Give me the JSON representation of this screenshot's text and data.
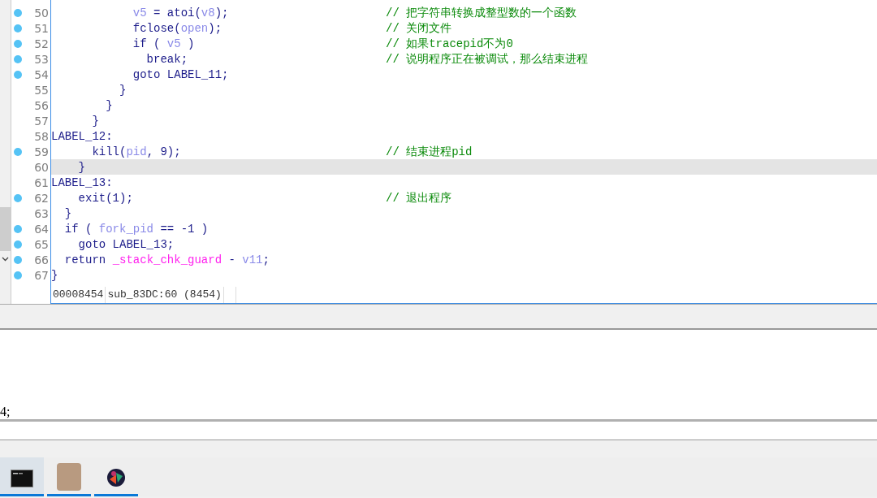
{
  "code_lines": [
    {
      "number": "50",
      "breakpoint": true,
      "selected": false,
      "tokens": [
        {
          "text": "            v5",
          "kind": "lvar"
        },
        {
          "text": " = atoi(",
          "kind": "code"
        },
        {
          "text": "v8",
          "kind": "lvar"
        },
        {
          "text": ");",
          "kind": "code"
        }
      ],
      "comment": "// 把字符串转换成整型数的一个函数"
    },
    {
      "number": "51",
      "breakpoint": true,
      "selected": false,
      "tokens": [
        {
          "text": "            fclose(",
          "kind": "code"
        },
        {
          "text": "open",
          "kind": "lvar"
        },
        {
          "text": ");",
          "kind": "code"
        }
      ],
      "comment": "// 关闭文件"
    },
    {
      "number": "52",
      "breakpoint": true,
      "selected": false,
      "tokens": [
        {
          "text": "            if ( ",
          "kind": "code"
        },
        {
          "text": "v5",
          "kind": "lvar"
        },
        {
          "text": " )",
          "kind": "code"
        }
      ],
      "comment": "// 如果tracepid不为0"
    },
    {
      "number": "53",
      "breakpoint": true,
      "selected": false,
      "tokens": [
        {
          "text": "              break;",
          "kind": "code"
        }
      ],
      "comment": "// 说明程序正在被调试，那么结束进程"
    },
    {
      "number": "54",
      "breakpoint": true,
      "selected": false,
      "tokens": [
        {
          "text": "            goto LABEL_11;",
          "kind": "code"
        }
      ]
    },
    {
      "number": "55",
      "breakpoint": false,
      "selected": false,
      "tokens": [
        {
          "text": "          }",
          "kind": "code"
        }
      ]
    },
    {
      "number": "56",
      "breakpoint": false,
      "selected": false,
      "tokens": [
        {
          "text": "        }",
          "kind": "code"
        }
      ]
    },
    {
      "number": "57",
      "breakpoint": false,
      "selected": false,
      "tokens": [
        {
          "text": "      }",
          "kind": "code"
        }
      ]
    },
    {
      "number": "58",
      "breakpoint": false,
      "selected": false,
      "tokens": [
        {
          "text": "LABEL_12:",
          "kind": "code"
        }
      ]
    },
    {
      "number": "59",
      "breakpoint": true,
      "selected": false,
      "tokens": [
        {
          "text": "      kill(",
          "kind": "code"
        },
        {
          "text": "pid",
          "kind": "lvar"
        },
        {
          "text": ", 9);",
          "kind": "code"
        }
      ],
      "comment": "// 结束进程pid"
    },
    {
      "number": "60",
      "breakpoint": false,
      "selected": true,
      "tokens": [
        {
          "text": "    }",
          "kind": "code"
        }
      ]
    },
    {
      "number": "61",
      "breakpoint": false,
      "selected": false,
      "tokens": [
        {
          "text": "LABEL_13:",
          "kind": "code"
        }
      ]
    },
    {
      "number": "62",
      "breakpoint": true,
      "selected": false,
      "tokens": [
        {
          "text": "    exit(1);",
          "kind": "code"
        }
      ],
      "comment": "// 退出程序"
    },
    {
      "number": "63",
      "breakpoint": false,
      "selected": false,
      "tokens": [
        {
          "text": "  }",
          "kind": "code"
        }
      ]
    },
    {
      "number": "64",
      "breakpoint": true,
      "selected": false,
      "tokens": [
        {
          "text": "  if ( ",
          "kind": "code"
        },
        {
          "text": "fork_pid",
          "kind": "lvar"
        },
        {
          "text": " == -1 )",
          "kind": "code"
        }
      ]
    },
    {
      "number": "65",
      "breakpoint": true,
      "selected": false,
      "tokens": [
        {
          "text": "    goto LABEL_13;",
          "kind": "code"
        }
      ]
    },
    {
      "number": "66",
      "breakpoint": true,
      "selected": false,
      "tokens": [
        {
          "text": "  return ",
          "kind": "code"
        },
        {
          "text": "_stack_chk_guard",
          "kind": "global"
        },
        {
          "text": " - ",
          "kind": "code"
        },
        {
          "text": "v11",
          "kind": "lvar"
        },
        {
          "text": ";",
          "kind": "code"
        }
      ]
    },
    {
      "number": "67",
      "breakpoint": true,
      "selected": false,
      "tokens": [
        {
          "text": "}",
          "kind": "code"
        }
      ]
    }
  ],
  "status_bar": {
    "address": "00008454",
    "location": "sub_83DC:60 (8454)"
  },
  "output": {
    "text": "4;"
  },
  "taskbar": [
    {
      "kind": "terminal",
      "selected": true
    },
    {
      "kind": "photo",
      "selected": false
    },
    {
      "kind": "app",
      "selected": false
    }
  ]
}
